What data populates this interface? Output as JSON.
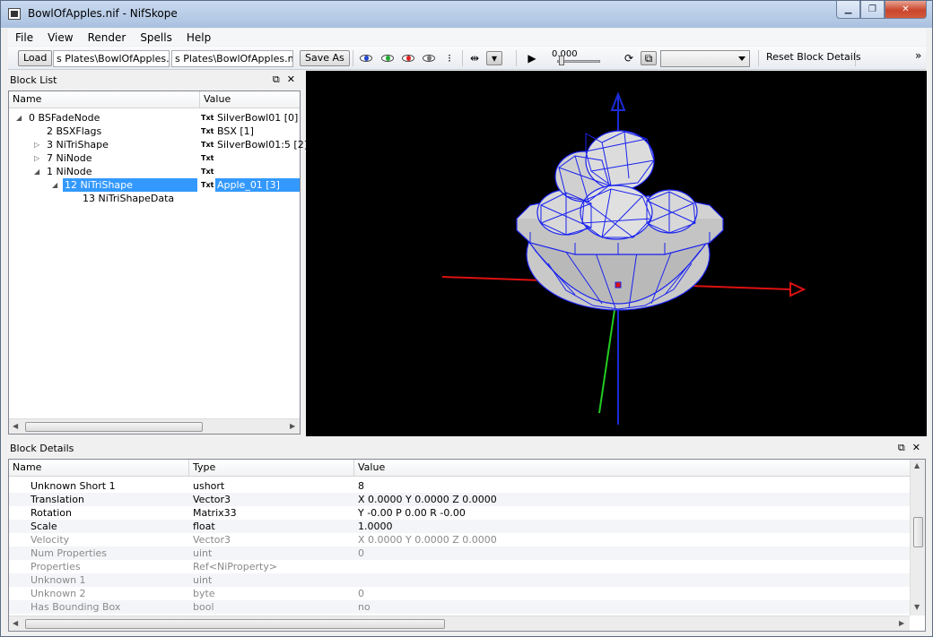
{
  "window": {
    "title": "BowlOfApples.nif - NifSkope",
    "controls": [
      "min",
      "max",
      "close"
    ]
  },
  "menu": [
    "File",
    "View",
    "Render",
    "Spells",
    "Help"
  ],
  "toolbar": {
    "load_label": "Load",
    "load_path": "s Plates\\BowlOfApples.nif",
    "save_path": "s Plates\\BowlOfApples.nif",
    "save_label": "Save As",
    "time_value": "0.000",
    "time_slider_fraction": 0.0,
    "reset_label": "Reset Block Details",
    "overflow": "»"
  },
  "block_list": {
    "title": "Block List",
    "columns": [
      "Name",
      "Value"
    ],
    "rows": [
      {
        "expander": "◢",
        "name": "0 BSFadeNode",
        "badge": "Txt",
        "value": "SilverBowl01 [0]",
        "selected": false
      },
      {
        "expander": "",
        "name": "2 BSXFlags",
        "badge": "Txt",
        "value": "BSX [1]",
        "selected": false
      },
      {
        "expander": "▷",
        "name": "3 NiTriShape",
        "badge": "Txt",
        "value": "SilverBowl01:5 [2]",
        "selected": false
      },
      {
        "expander": "▷",
        "name": "7 NiNode",
        "badge": "Txt",
        "value": "",
        "selected": false
      },
      {
        "expander": "◢",
        "name": "1 NiNode",
        "badge": "Txt",
        "value": "",
        "selected": false
      },
      {
        "expander": "◢",
        "name": "12 NiTriShape",
        "badge": "Txt",
        "value": "Apple_01 [3]",
        "selected": true
      },
      {
        "expander": "",
        "name": "13 NiTriShapeData",
        "badge": "",
        "value": "",
        "selected": false
      }
    ]
  },
  "block_details": {
    "title": "Block Details",
    "columns": [
      "Name",
      "Type",
      "Value"
    ],
    "rows": [
      {
        "name": "Unknown Short 1",
        "type": "ushort",
        "value": "8",
        "dim": false
      },
      {
        "name": "Translation",
        "type": "Vector3",
        "value": "X 0.0000 Y 0.0000 Z 0.0000",
        "dim": false
      },
      {
        "name": "Rotation",
        "type": "Matrix33",
        "value": "Y -0.00 P 0.00 R -0.00",
        "dim": false
      },
      {
        "name": "Scale",
        "type": "float",
        "value": "1.0000",
        "dim": false
      },
      {
        "name": "Velocity",
        "type": "Vector3",
        "value": "X 0.0000 Y 0.0000 Z 0.0000",
        "dim": true
      },
      {
        "name": "Num Properties",
        "type": "uint",
        "value": "0",
        "dim": true
      },
      {
        "name": "Properties",
        "type": "Ref<NiProperty>",
        "value": "",
        "dim": true
      },
      {
        "name": "Unknown 1",
        "type": "uint",
        "value": "",
        "dim": true
      },
      {
        "name": "Unknown 2",
        "type": "byte",
        "value": "0",
        "dim": true
      },
      {
        "name": "Has Bounding Box",
        "type": "bool",
        "value": "no",
        "dim": true
      }
    ]
  },
  "colors": {
    "selection": "#3399ff",
    "viewport_bg": "#000000",
    "axis_x": "#dd1111",
    "axis_y": "#22cc22",
    "axis_z": "#1a2bd6",
    "wireframe": "#1a22ee"
  }
}
